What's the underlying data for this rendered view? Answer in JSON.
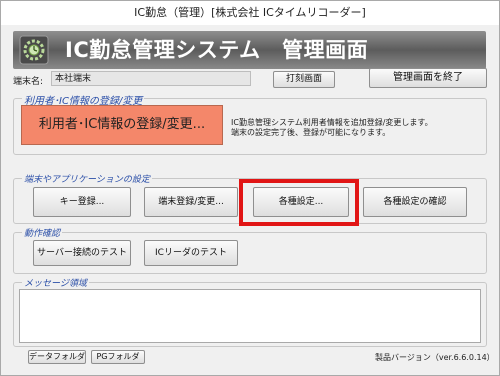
{
  "window": {
    "title": "IC勤怠（管理）[株式会社 ICタイムリコーダー]"
  },
  "banner": {
    "title": "IC勤怠管理システム　管理画面",
    "icon": "gear-clock-icon"
  },
  "terminal": {
    "label": "端末名:",
    "value": "本社端末"
  },
  "toolbar": {
    "print_label": "打刻画面",
    "exit_label": "管理画面を終了"
  },
  "registration_group": {
    "legend": "利用者･IC情報の登録/変更",
    "button_label": "利用者･IC情報の登録/変更...",
    "description_line1": "IC勤怠管理システム利用者情報を追加登録/変更します。",
    "description_line2": "端末の設定完了後、登録が可能になります。"
  },
  "settings_group": {
    "legend": "端末やアプリケーションの設定",
    "buttons": [
      "キー登録...",
      "端末登録/変更...",
      "各種設定...",
      "各種設定の確認"
    ]
  },
  "check_group": {
    "legend": "動作確認",
    "buttons": [
      "サーバー接続のテスト",
      "ICリーダのテスト"
    ]
  },
  "message_group": {
    "legend": "メッセージ領域",
    "content": ""
  },
  "footer": {
    "data_folder_label": "データフォルダ",
    "pg_folder_label": "PGフォルダ",
    "version": "製品バージョン（ver.6.6.0.14）"
  },
  "colors": {
    "highlight": "#e11515",
    "orange_button": "#f4876a",
    "legend_text": "#2b4fa8"
  }
}
